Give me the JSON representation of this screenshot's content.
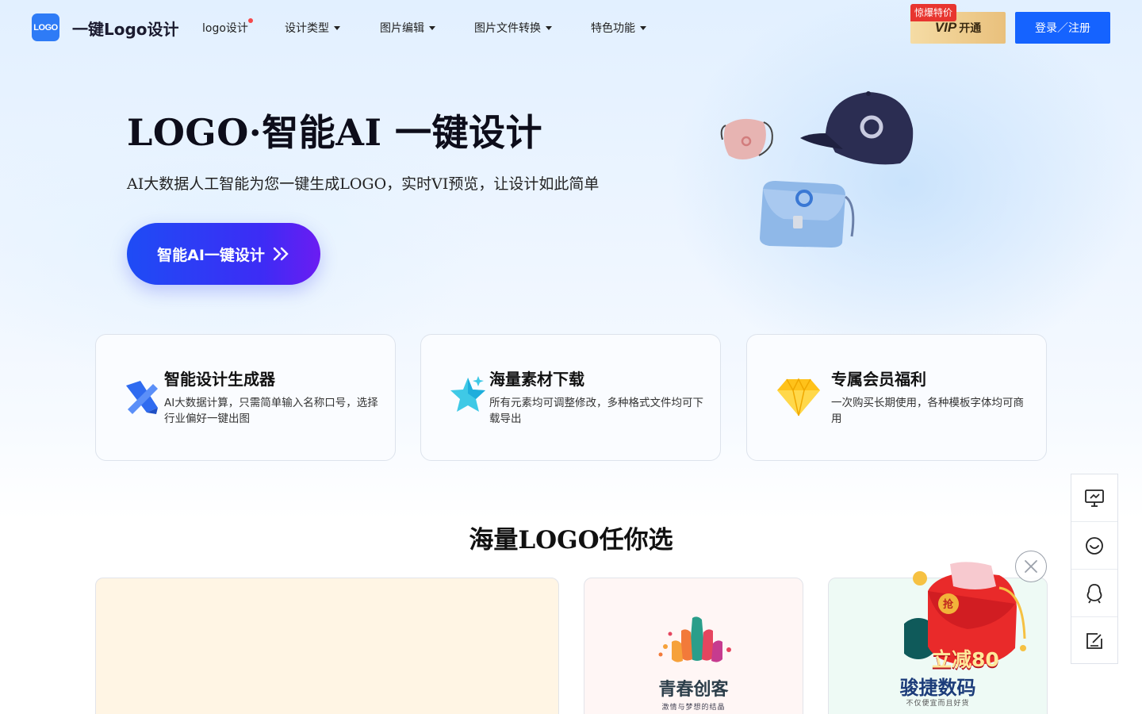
{
  "header": {
    "logo_mark": "LOGO",
    "site_name": "一键Logo设计",
    "nav": [
      {
        "label": "logo设计"
      },
      {
        "label": "设计类型"
      },
      {
        "label": "图片编辑"
      },
      {
        "label": "图片文件转换"
      },
      {
        "label": "特色功能"
      }
    ],
    "vip_badge": "惊爆特价",
    "vip_label": "VIP",
    "vip_open": "开通",
    "login_label": "登录／注册"
  },
  "hero": {
    "title": "LOGO·智能AI 一键设计",
    "subtitle": "AI大数据人工智能为您一键生成LOGO，实时VI预览，让设计如此简单",
    "cta_label": "智能AI一键设计"
  },
  "features": [
    {
      "title": "智能设计生成器",
      "desc": "AI大数据计算，只需简单输入名称口号，选择行业偏好一键出图",
      "icon": "pencil-ruler-icon"
    },
    {
      "title": "海量素材下载",
      "desc": "所有元素均可调整修改，多种格式文件均可下载导出",
      "icon": "star-icon"
    },
    {
      "title": "专属会员福利",
      "desc": "一次购买长期使用，各种模板字体均可商用",
      "icon": "diamond-icon"
    }
  ],
  "section": {
    "title": "海量LOGO任你选"
  },
  "logo_cards": [
    {
      "name": "",
      "slogan": ""
    },
    {
      "name": "青春创客",
      "slogan": "激情与梦想的结晶"
    },
    {
      "name": "骏捷数码",
      "slogan": "不仅便宜而且好货"
    }
  ],
  "promo": {
    "text": "立减80",
    "coupon_char": "抢"
  },
  "side_tools": [
    "monitor-icon",
    "chat-smile-icon",
    "qq-icon",
    "edit-note-icon"
  ],
  "colors": {
    "primary": "#1563ff",
    "cta_gradient_start": "#1e4cf5",
    "cta_gradient_end": "#6b1cf2",
    "vip_gold": "#e9c07c",
    "badge_red": "#e8352f"
  }
}
